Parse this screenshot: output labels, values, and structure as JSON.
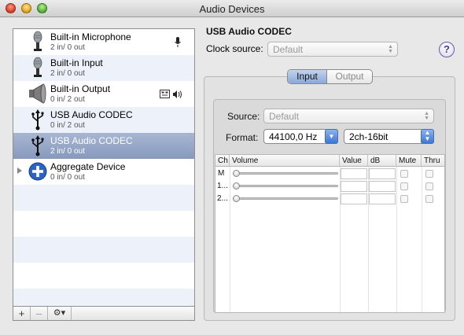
{
  "window": {
    "title": "Audio Devices"
  },
  "devices": [
    {
      "name": "Built-in Microphone",
      "io": "2 in/ 0 out",
      "icon": "microphone-icon",
      "badge": "microphone-badge-icon"
    },
    {
      "name": "Built-in Input",
      "io": "2 in/ 0 out",
      "icon": "microphone-icon",
      "badge": ""
    },
    {
      "name": "Built-in Output",
      "io": "0 in/ 2 out",
      "icon": "speaker-icon",
      "badge": "finder-speaker-badge-icon"
    },
    {
      "name": "USB Audio CODEC",
      "io": "0 in/ 2 out",
      "icon": "usb-icon",
      "badge": ""
    },
    {
      "name": "USB Audio CODEC",
      "io": "2 in/ 0 out",
      "icon": "usb-icon",
      "badge": "",
      "selected": true
    },
    {
      "name": "Aggregate Device",
      "io": "0 in/ 0 out",
      "icon": "aggregate-plus-icon",
      "badge": ""
    }
  ],
  "bottom_bar": {
    "add": "+",
    "remove": "–",
    "gear": "⚙▾"
  },
  "detail": {
    "device_title": "USB Audio CODEC",
    "clock_source_label": "Clock source:",
    "clock_source_value": "Default",
    "help": "?",
    "tabs": [
      {
        "label": "Input",
        "active": true
      },
      {
        "label": "Output",
        "active": false
      }
    ],
    "source_label": "Source:",
    "source_value": "Default",
    "format_label": "Format:",
    "format_rate": "44100,0 Hz",
    "format_channels": "2ch-16bit",
    "table": {
      "headers": [
        "Ch",
        "Volume",
        "Value",
        "dB",
        "Mute",
        "Thru"
      ],
      "rows": [
        {
          "ch": "M",
          "volume": 0
        },
        {
          "ch": "1...",
          "volume": 0
        },
        {
          "ch": "2...",
          "volume": 0
        }
      ]
    }
  },
  "colors": {
    "selection": "#8799bd",
    "alt_row": "#edf2fa",
    "accent_blue": "#3f76d2"
  }
}
